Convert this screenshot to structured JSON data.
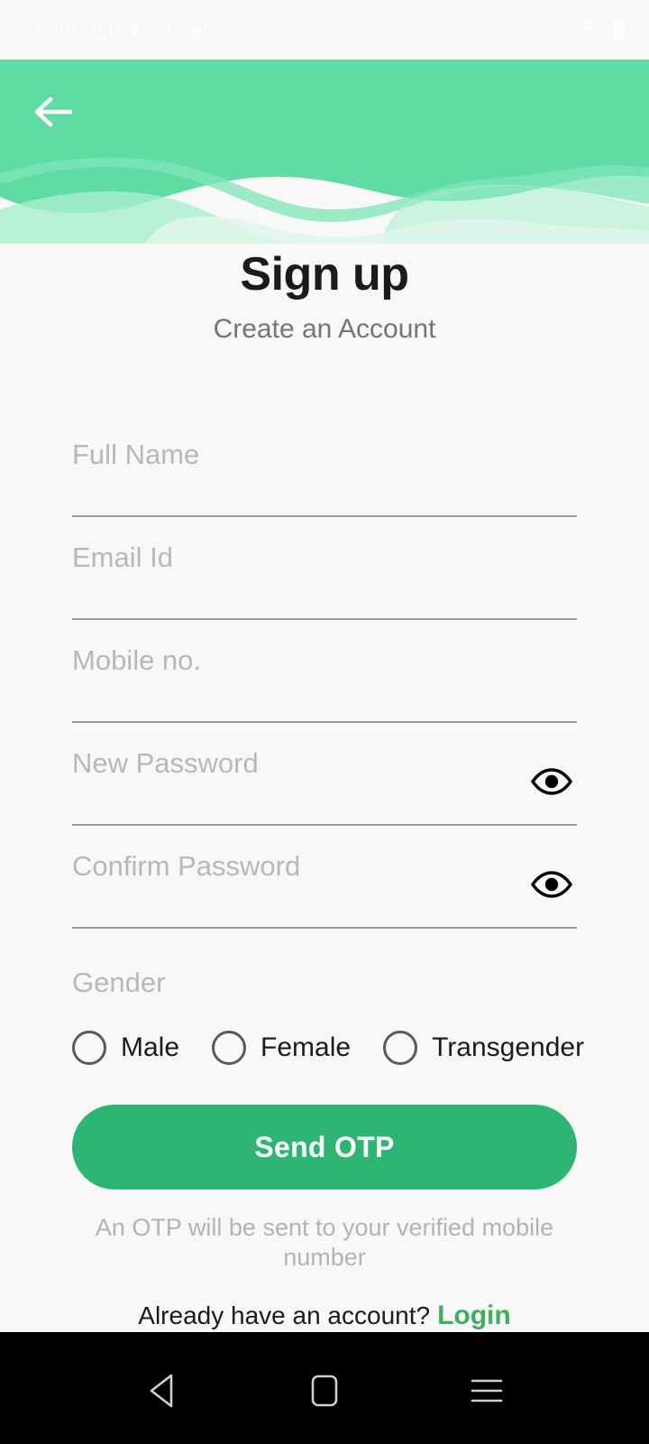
{
  "status_bar": {
    "time": "10:49",
    "left_icons": [
      "screenshot-icon",
      "bluetooth-icon",
      "vibrate-icon",
      "sim-icon"
    ],
    "right_icons": [
      "wifi-icon",
      "battery-icon"
    ]
  },
  "header": {
    "back_label": "Back",
    "back_icon": "arrow-left-icon",
    "wave_color_main": "#5FDCA4",
    "wave_color_light": "#A4EBC8",
    "wave_color_lighter": "#C8F2DD"
  },
  "page": {
    "title": "Sign up",
    "subtitle": "Create an Account"
  },
  "form": {
    "fields": [
      {
        "name": "full-name",
        "placeholder": "Full Name",
        "value": "",
        "type": "text",
        "has_eye": false
      },
      {
        "name": "email-id",
        "placeholder": "Email Id",
        "value": "",
        "type": "email",
        "has_eye": false
      },
      {
        "name": "mobile-no",
        "placeholder": "Mobile no.",
        "value": "",
        "type": "tel",
        "has_eye": false
      },
      {
        "name": "new-password",
        "placeholder": "New Password",
        "value": "",
        "type": "password",
        "has_eye": true
      },
      {
        "name": "confirm-password",
        "placeholder": "Confirm Password",
        "value": "",
        "type": "password",
        "has_eye": true
      }
    ],
    "eye_icon": "eye-icon"
  },
  "gender": {
    "label": "Gender",
    "options": [
      {
        "label": "Male",
        "selected": false
      },
      {
        "label": "Female",
        "selected": false
      },
      {
        "label": "Transgender",
        "selected": false
      }
    ]
  },
  "actions": {
    "primary_button": "Send OTP",
    "primary_button_color": "#2EB573",
    "otp_note": "An OTP will be sent to your verified mobile number",
    "login_prompt": "Already have an account?",
    "login_link": "Login",
    "login_link_color": "#3FAE5E"
  },
  "nav_bar": {
    "items": [
      {
        "name": "back-nav-button",
        "icon": "triangle-back-icon"
      },
      {
        "name": "home-nav-button",
        "icon": "square-home-icon"
      },
      {
        "name": "recents-nav-button",
        "icon": "hamburger-recents-icon"
      }
    ]
  }
}
